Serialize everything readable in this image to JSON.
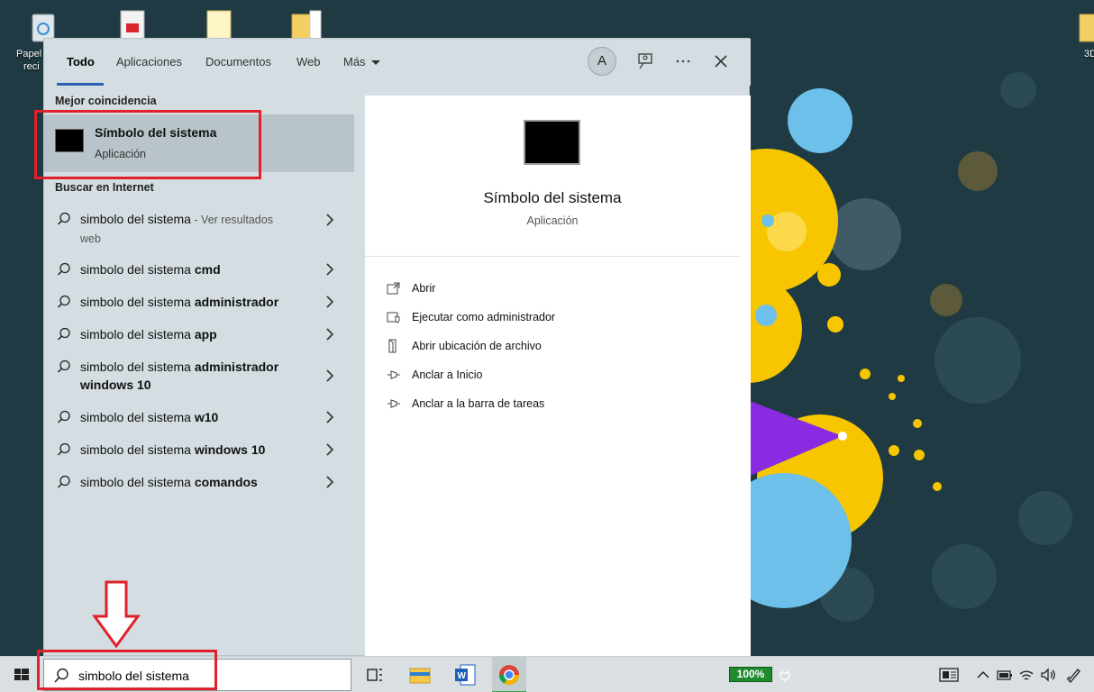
{
  "desktop": {
    "icons": [
      {
        "label": "Papel",
        "label2": "reci",
        "icon": "recycle-bin-icon"
      },
      {
        "label": "",
        "icon": "pdf-file-icon"
      },
      {
        "label": "",
        "icon": "document-file-icon"
      },
      {
        "label": "",
        "icon": "folder-icon"
      },
      {
        "label": "3D",
        "icon": "folder-icon"
      }
    ]
  },
  "search_panel": {
    "tabs": [
      {
        "label": "Todo",
        "active": true
      },
      {
        "label": "Aplicaciones"
      },
      {
        "label": "Documentos"
      },
      {
        "label": "Web"
      },
      {
        "label": "Más"
      }
    ],
    "avatar_initial": "A",
    "best_match": {
      "heading": "Mejor coincidencia",
      "title": "Símbolo del sistema",
      "subtitle": "Aplicación",
      "icon": "command-prompt-icon"
    },
    "web_search": {
      "heading": "Buscar en Internet",
      "items": [
        {
          "base": "simbolo del sistema",
          "bold": "",
          "hint": " - Ver resultados",
          "hint2": "web"
        },
        {
          "base": "simbolo del sistema ",
          "bold": "cmd"
        },
        {
          "base": "simbolo del sistema ",
          "bold": "administrador"
        },
        {
          "base": "simbolo del sistema ",
          "bold": "app"
        },
        {
          "base": "simbolo del sistema ",
          "bold": "administrador",
          "bold2": "windows 10"
        },
        {
          "base": "simbolo del sistema ",
          "bold": "w10"
        },
        {
          "base": "simbolo del sistema ",
          "bold": "windows 10"
        },
        {
          "base": "simbolo del sistema ",
          "bold": "comandos"
        }
      ]
    },
    "detail": {
      "title": "Símbolo del sistema",
      "subtitle": "Aplicación",
      "actions": [
        {
          "label": "Abrir",
          "icon": "open-icon"
        },
        {
          "label": "Ejecutar como administrador",
          "icon": "admin-shield-icon"
        },
        {
          "label": "Abrir ubicación de archivo",
          "icon": "file-location-icon"
        },
        {
          "label": "Anclar a Inicio",
          "icon": "pin-icon"
        },
        {
          "label": "Anclar a la barra de tareas",
          "icon": "pin-icon"
        }
      ]
    }
  },
  "taskbar": {
    "search_value": "simbolo del sistema",
    "battery_label": "100%",
    "apps": [
      "task-view-icon",
      "file-explorer-icon",
      "word-icon",
      "chrome-icon"
    ]
  },
  "colors": {
    "accent": "#2b62b8",
    "annotation_red": "#e0202a",
    "wallpaper_bg": "#1f3a42",
    "yellow": "#f7c600",
    "blue": "#6cc0ea",
    "purple": "#8a2be2"
  }
}
